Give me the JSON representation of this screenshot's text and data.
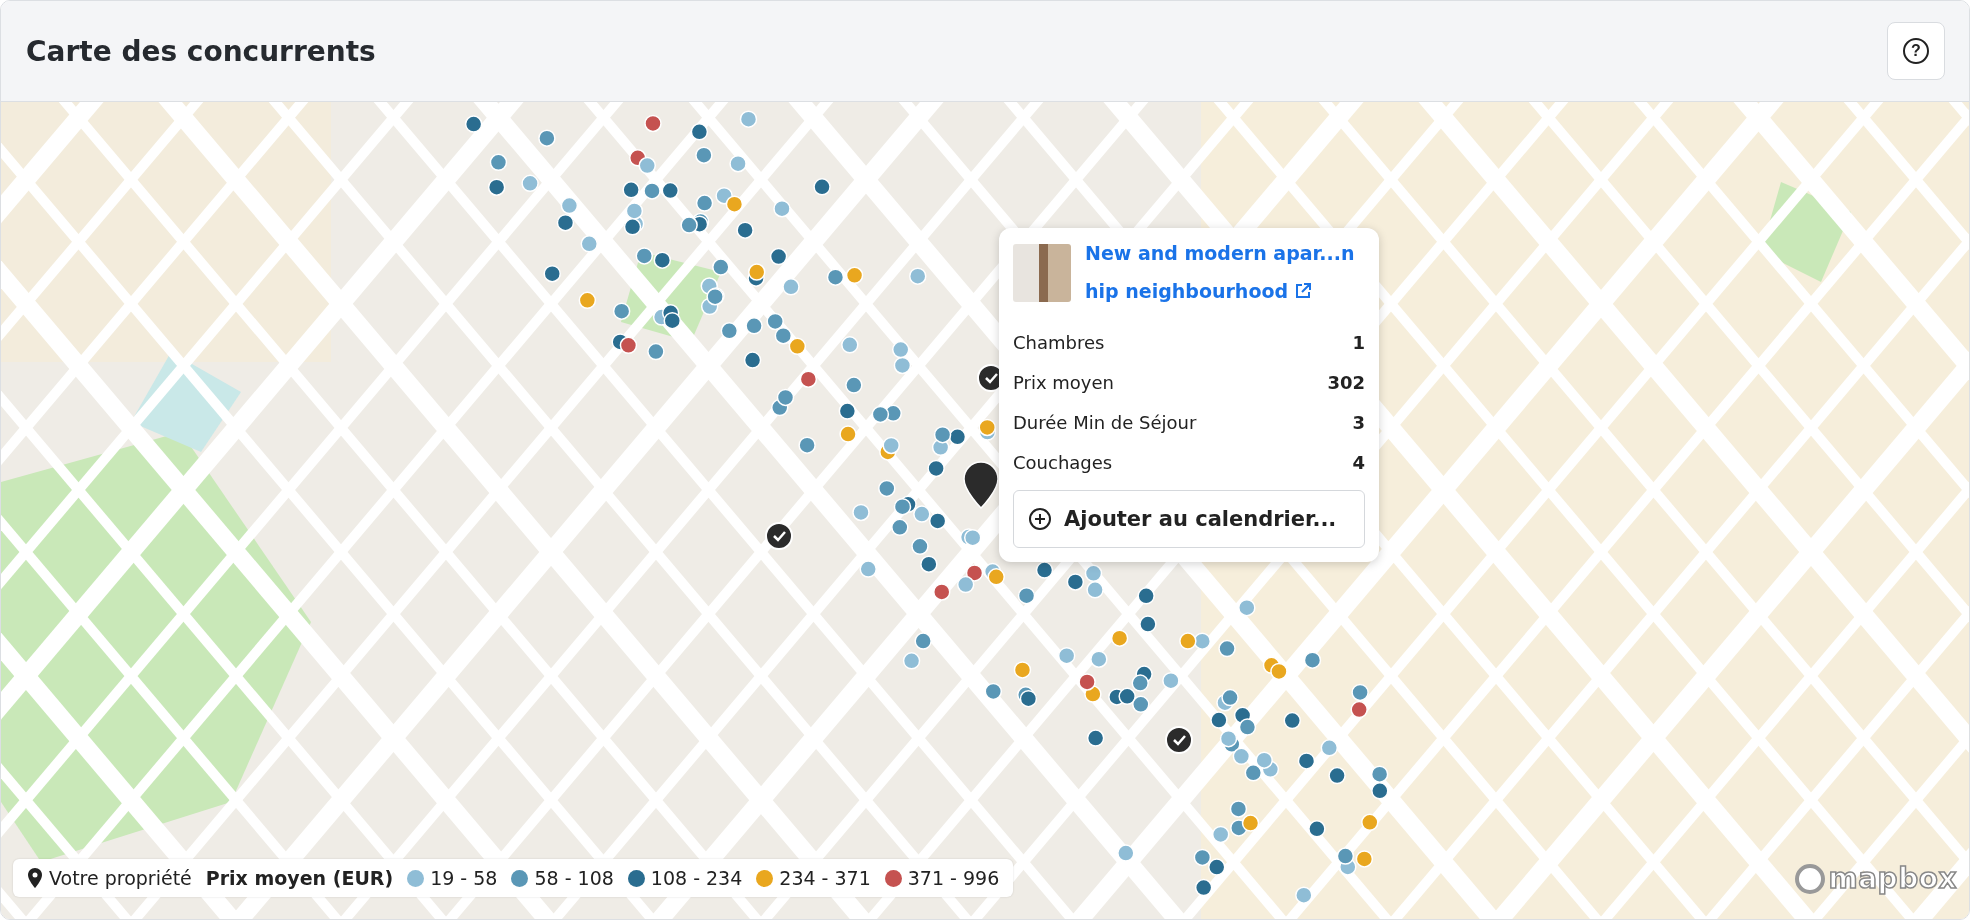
{
  "header": {
    "title": "Carte des concurrents",
    "help_label": "?"
  },
  "popup": {
    "title": "New and modern apar...n hip neighbourhood",
    "fields": [
      {
        "label": "Chambres",
        "value": "1"
      },
      {
        "label": "Prix moyen",
        "value": "302"
      },
      {
        "label": "Durée Min de Séjour",
        "value": "3"
      },
      {
        "label": "Couchages",
        "value": "4"
      }
    ],
    "button": "Ajouter au calendrier..."
  },
  "legend": {
    "own_property": "Votre propriété",
    "title": "Prix moyen (EUR)",
    "ranges": [
      {
        "label": "19 - 58",
        "color": "#8fbdd6"
      },
      {
        "label": "58 - 108",
        "color": "#5a97b6"
      },
      {
        "label": "108 - 234",
        "color": "#2a6d90"
      },
      {
        "label": "234 - 371",
        "color": "#e9a71f"
      },
      {
        "label": "371 - 996",
        "color": "#c55250"
      }
    ]
  },
  "map": {
    "attribution": "mapbox"
  }
}
